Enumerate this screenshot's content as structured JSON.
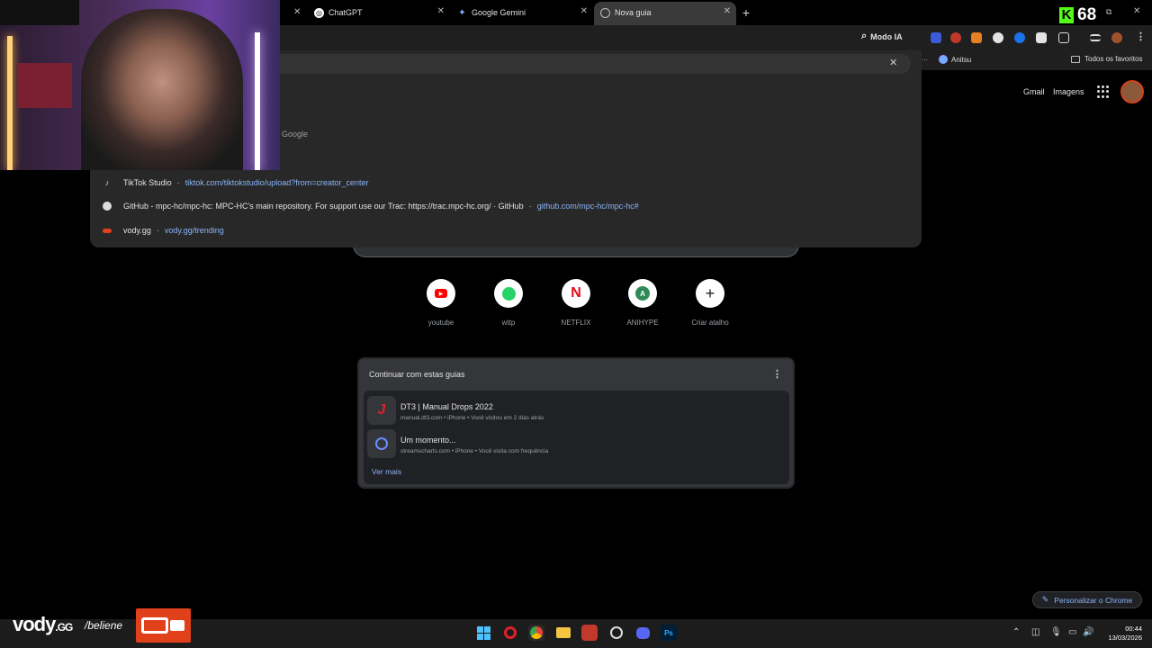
{
  "tabs": [
    {
      "label": "ChatGPT",
      "active": false
    },
    {
      "label": "Google Gemini",
      "active": false
    },
    {
      "label": "Nova guia",
      "active": true
    }
  ],
  "kick": {
    "letter": "K",
    "count": "68"
  },
  "toolbar": {
    "modo_ia_label": "Modo IA"
  },
  "bookmarks": {
    "overflow": "...",
    "items": [
      "Anitsu"
    ],
    "all_label": "Todos os favoritos"
  },
  "ntp_header": {
    "gmail": "Gmail",
    "images": "Imagens"
  },
  "omnibox": {
    "google_suggestion": "Google",
    "suggestions": [
      {
        "icon": "tiktok-icon",
        "title": "TikTok Studio",
        "url": "tiktok.com/tiktokstudio/upload?from=creator_center"
      },
      {
        "icon": "github-icon",
        "title": "GitHub - mpc-hc/mpc-hc: MPC-HC's main repository. For support use our Trac: https://trac.mpc-hc.org/ · GitHub",
        "url": "github.com/mpc-hc/mpc-hc#"
      },
      {
        "icon": "vody-icon",
        "title": "vody.gg",
        "url": "vody.gg/trending"
      }
    ]
  },
  "shortcuts": [
    {
      "label": "youtube",
      "icon": "youtube-icon"
    },
    {
      "label": "wttp",
      "icon": "whatsapp-icon"
    },
    {
      "label": "NETFLIX",
      "icon": "netflix-icon"
    },
    {
      "label": "ANIHYPE",
      "icon": "anihype-icon",
      "glyph": "A"
    },
    {
      "label": "Criar atalho",
      "icon": "plus-icon",
      "glyph": "+"
    }
  ],
  "continue_card": {
    "title": "Continuar com estas guias",
    "items": [
      {
        "title": "DT3 | Manual Drops 2022",
        "meta": "manual.dt3.com • iPhone • Você visitou em 2 dias atrás"
      },
      {
        "title": "Um momento...",
        "meta": "streamscharts.com • iPhone • Você visita com frequência"
      }
    ],
    "more": "Ver mais"
  },
  "personalize": "Personalizar o Chrome",
  "clock": {
    "time": "00:44",
    "date": "13/03/2026"
  },
  "overlay": {
    "brand": "vody",
    "brand_suffix": ".GG",
    "tagline": "/beliene"
  },
  "colors": {
    "accent_link": "#8ab4f8",
    "kick_green": "#53fc18",
    "vody_orange": "#e0401a"
  }
}
